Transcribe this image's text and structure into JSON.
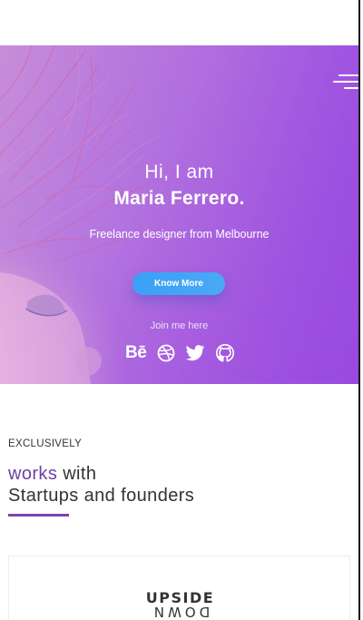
{
  "hero": {
    "greeting": "Hi, I am",
    "name": "Maria Ferrero.",
    "tagline": "Freelance designer from Melbourne",
    "cta_label": "Know More",
    "join_text": "Join me here",
    "social_behance": "Bē",
    "social_icons": [
      "behance-icon",
      "dribbble-icon",
      "twitter-icon",
      "github-icon"
    ],
    "menu_icon": "hamburger-menu-icon"
  },
  "section": {
    "eyebrow": "EXCLUSIVELY",
    "title_accent": "works",
    "title_rest": " with",
    "title_line2": "Startups and founders"
  },
  "work_card": {
    "logo_top": "UPSIDE",
    "logo_bottom": "DOWN"
  },
  "colors": {
    "accent_purple": "#6f3fa6",
    "button_blue": "#3aa0f7",
    "hero_purple": "#a55ae0"
  }
}
